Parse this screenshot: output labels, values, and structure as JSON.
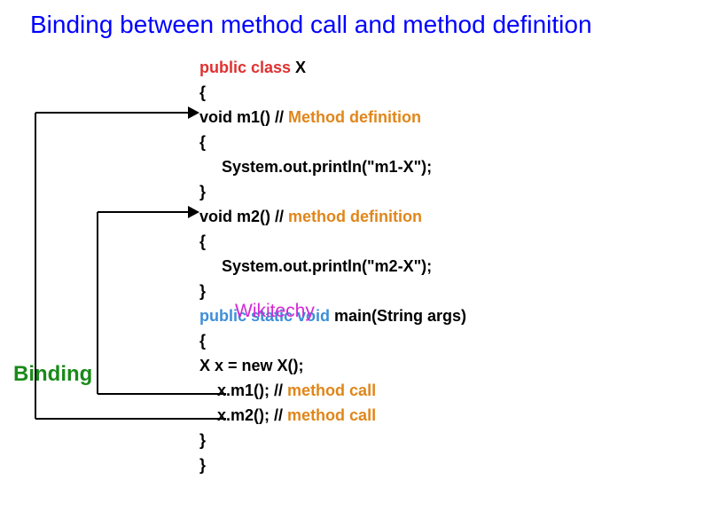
{
  "title": "Binding between method call and method definition",
  "binding_label": "Binding",
  "watermark": "Wikitechy",
  "code": {
    "l0_kw": "public class ",
    "l0_name": "X",
    "l1": "{",
    "l2_sig": "void m1() ",
    "l2_slash": "//",
    "l2_comment": " Method definition",
    "l3": "{",
    "l4": "System.out.println(\"m1-X\");",
    "l5": "}",
    "l6_sig": "void m2() ",
    "l6_slash": "//",
    "l6_comment": " method definition",
    "l7": "{",
    "l8": "System.out.println(\"m2-X\");",
    "l9": "}",
    "l10_kw": "public static void ",
    "l10_sig": "main(String args)",
    "l11": "{",
    "l12": "X x = new X();",
    "l13_call": "x.m1(); ",
    "l13_slash": "//",
    "l13_comment": " method call",
    "l14_call": "x.m2(); ",
    "l14_slash": "//",
    "l14_comment": " method call",
    "l15": "}",
    "l16": "}"
  }
}
